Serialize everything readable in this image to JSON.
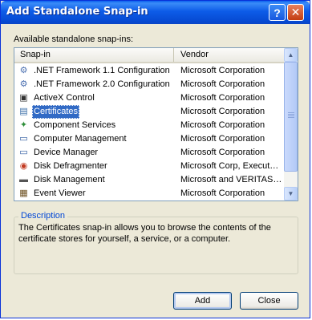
{
  "window": {
    "title": "Add Standalone Snap-in",
    "help_glyph": "?",
    "close_glyph": "✕"
  },
  "available_label": "Available standalone snap-ins:",
  "list": {
    "columns": {
      "snapin": "Snap-in",
      "vendor": "Vendor"
    },
    "rows": [
      {
        "icon": "gear-icon",
        "glyph": "⚙",
        "color": "#4a6fb0",
        "name": ".NET Framework 1.1 Configuration",
        "vendor": "Microsoft Corporation"
      },
      {
        "icon": "gear-icon",
        "glyph": "⚙",
        "color": "#4a6fb0",
        "name": ".NET Framework 2.0 Configuration",
        "vendor": "Microsoft Corporation"
      },
      {
        "icon": "activex-icon",
        "glyph": "▣",
        "color": "#333333",
        "name": "ActiveX Control",
        "vendor": "Microsoft Corporation"
      },
      {
        "icon": "certificate-icon",
        "glyph": "▤",
        "color": "#3a6ea8",
        "name": "Certificates",
        "vendor": "Microsoft Corporation",
        "selected": true
      },
      {
        "icon": "component-services-icon",
        "glyph": "✦",
        "color": "#2f8f3a",
        "name": "Component Services",
        "vendor": "Microsoft Corporation"
      },
      {
        "icon": "computer-icon",
        "glyph": "▭",
        "color": "#2d5aa0",
        "name": "Computer Management",
        "vendor": "Microsoft Corporation"
      },
      {
        "icon": "device-manager-icon",
        "glyph": "▭",
        "color": "#2d5aa0",
        "name": "Device Manager",
        "vendor": "Microsoft Corporation"
      },
      {
        "icon": "defragmenter-icon",
        "glyph": "◉",
        "color": "#c23b22",
        "name": "Disk Defragmenter",
        "vendor": "Microsoft Corp, Execut…"
      },
      {
        "icon": "disk-management-icon",
        "glyph": "▬",
        "color": "#555555",
        "name": "Disk Management",
        "vendor": "Microsoft and VERITAS…"
      },
      {
        "icon": "event-viewer-icon",
        "glyph": "▦",
        "color": "#6b4e1e",
        "name": "Event Viewer",
        "vendor": "Microsoft Corporation"
      }
    ],
    "scroll_up_glyph": "▲",
    "scroll_down_glyph": "▼"
  },
  "description": {
    "legend": "Description",
    "text": "The Certificates snap-in allows you to browse the contents of the certificate stores for yourself, a service, or a computer."
  },
  "buttons": {
    "add": "Add",
    "close": "Close"
  },
  "colors": {
    "titlebar": "#0a5fee",
    "selection": "#316ac5",
    "group_legend": "#0046d5"
  }
}
